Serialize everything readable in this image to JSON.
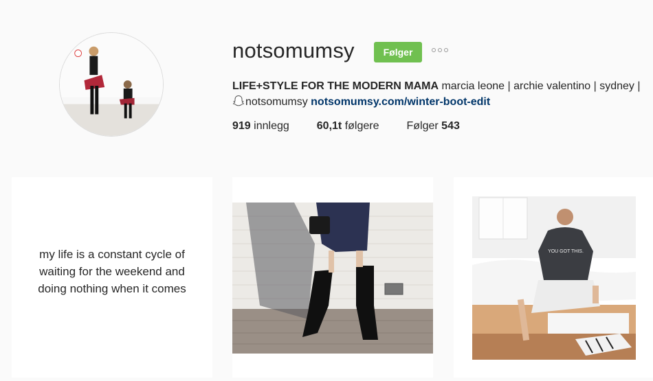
{
  "profile": {
    "username": "notsomumsy",
    "follow_label": "Følger",
    "bio_name": "LIFE+STYLE FOR THE MODERN MAMA",
    "bio_text": "marcia leone | archie valentino | sydney |",
    "bio_snapchat": "notsomumsy",
    "bio_link": "notsomumsy.com/winter-boot-edit"
  },
  "stats": {
    "posts_count": "919",
    "posts_label": "innlegg",
    "followers_count": "60,1t",
    "followers_label": "følgere",
    "following_label": "Følger",
    "following_count": "543"
  },
  "posts": [
    {
      "type": "text-quote",
      "lines": [
        "my life is a constant cycle of",
        "waiting for the weekend and",
        "doing nothing when it comes"
      ]
    },
    {
      "type": "photo",
      "icon": "boots-photo"
    },
    {
      "type": "photo",
      "icon": "bedroom-photo",
      "shirt_text": "YOU GOT THIS."
    }
  ],
  "colors": {
    "follow_green": "#70c050",
    "link_blue": "#003569",
    "background": "#fafafa"
  }
}
